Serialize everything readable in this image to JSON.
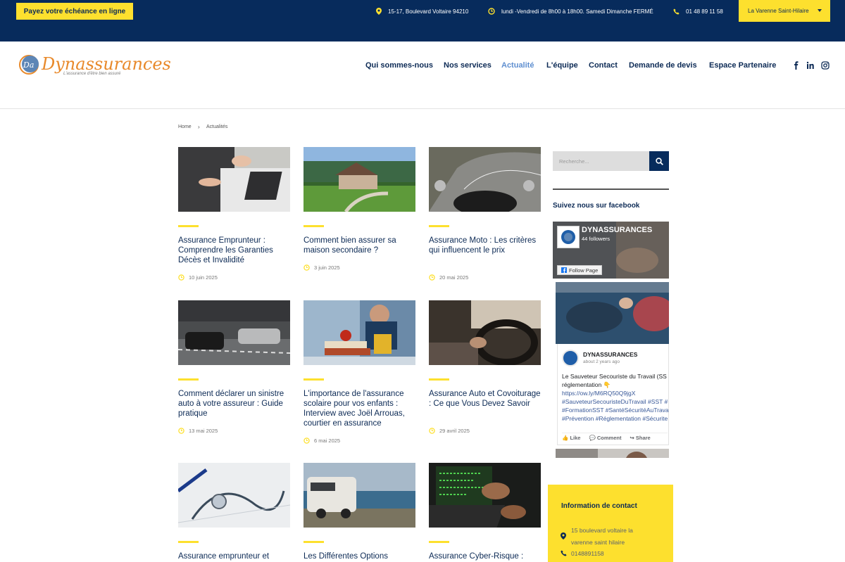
{
  "topbar": {
    "pay_label": "Payez votre échéance en ligne",
    "address": "15-17, Boulevard Voltaire 94210",
    "hours": "lundi -Vendredi de 8h00 à 18h00. Samedi Dimanche FERMÉ",
    "phone": "01 48 89 11 58",
    "city_select": "La Varenne Saint-Hilaire"
  },
  "brand": {
    "name": "Dynassurances",
    "tagline": "L'assurance d'être bien assuré",
    "accent": "#e8892a"
  },
  "nav": [
    {
      "label": "Qui sommes-nous"
    },
    {
      "label": "Nos services"
    },
    {
      "label": "Actualité",
      "active": true
    },
    {
      "label": "L'équipe"
    },
    {
      "label": "Contact"
    },
    {
      "label": "Demande de devis"
    },
    {
      "label": "Espace Partenaire"
    }
  ],
  "social": [
    "facebook-icon",
    "linkedin-icon",
    "instagram-icon"
  ],
  "breadcrumb": {
    "home": "Home",
    "current": "Actualités"
  },
  "articles": [
    {
      "title": "Assurance Emprunteur : Comprendre les Garanties Décès et Invalidité",
      "date": "10 juin 2025"
    },
    {
      "title": "Comment bien assurer sa maison secondaire ?",
      "date": "3 juin 2025"
    },
    {
      "title": "Assurance Moto : Les critères qui influencent le prix",
      "date": "20 mai 2025"
    },
    {
      "title": "Comment déclarer un sinistre auto à votre assureur : Guide pratique",
      "date": "13 mai 2025"
    },
    {
      "title": "L'importance de l'assurance scolaire pour vos enfants : Interview avec Joël Arrouas, courtier en assurance",
      "date": "6 mai 2025"
    },
    {
      "title": "Assurance Auto et Covoiturage : Ce que Vous Devez Savoir",
      "date": "29 avril 2025"
    },
    {
      "title": "Assurance emprunteur et",
      "date": ""
    },
    {
      "title": "Les Différentes Options",
      "date": ""
    },
    {
      "title": "Assurance Cyber-Risque :",
      "date": ""
    }
  ],
  "sidebar": {
    "search_placeholder": "Recherche...",
    "facebook_heading": "Suivez nous sur facebook",
    "fb_page_name": "DYNASSURANCES",
    "fb_followers": "44 followers",
    "fb_follow_label": "Follow Page",
    "fb_post_author": "DYNASSURANCES",
    "fb_post_time": "about 2 years ago",
    "fb_post_lines": [
      "Le Sauveteur Secouriste du Travail (SS",
      "réglementation 👇",
      "https://ow.ly/M6RQ50Q9jgX",
      "#SauveteurSecouristeDuTravail #SST #",
      "#FormationSST #SantéSécuritéAuTrava",
      "#Prévention #Réglementation #Sécurite"
    ],
    "fb_like": "Like",
    "fb_comment": "Comment",
    "fb_share": "Share",
    "contact_heading": "Information de contact",
    "contact_address_1": "15 boulevard voltaire la",
    "contact_address_2": "varenne saint hilaire",
    "contact_phone": "0148891158"
  },
  "colors": {
    "navy": "#072b5c",
    "yellow": "#fde02e",
    "link_active": "#5f8fd0"
  }
}
